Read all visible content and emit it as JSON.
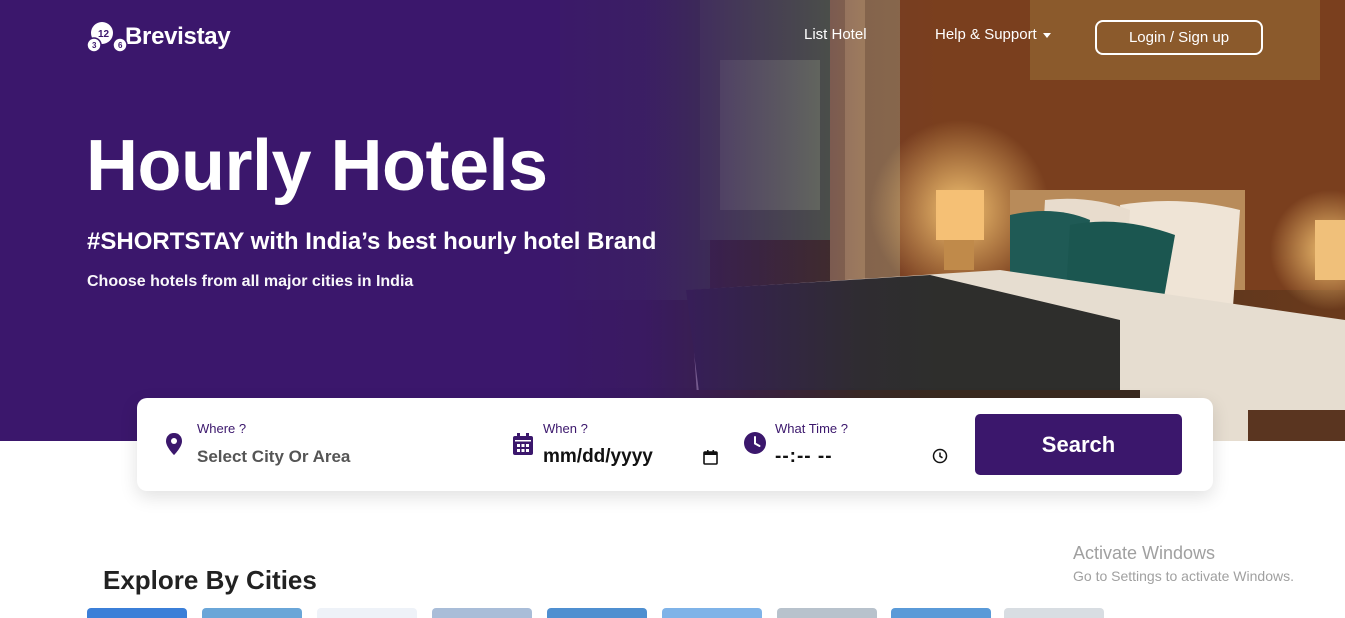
{
  "brand": {
    "name": "Brevistay",
    "logo_icon": "brevistay-logo-icon"
  },
  "nav": {
    "list_hotel": "List Hotel",
    "help_support": "Help & Support",
    "login": "Login / Sign up"
  },
  "hero": {
    "title": "Hourly Hotels",
    "subtitle": "#SHORTSTAY with India’s best hourly hotel Brand",
    "description": "Choose hotels from all major cities in India"
  },
  "search": {
    "where_label": "Where ?",
    "where_placeholder": "Select City Or Area",
    "when_label": "When ?",
    "when_value": "mm/dd/yyyy",
    "time_label": "What Time ?",
    "time_value": "--:-- --",
    "button": "Search",
    "icons": [
      "map-pin-icon",
      "calendar-icon",
      "clock-icon"
    ]
  },
  "explore": {
    "title": "Explore By Cities"
  },
  "watermark": {
    "line1": "Activate Windows",
    "line2": "Go to Settings to activate Windows."
  },
  "colors": {
    "brand_purple": "#3b176c",
    "white": "#ffffff"
  }
}
